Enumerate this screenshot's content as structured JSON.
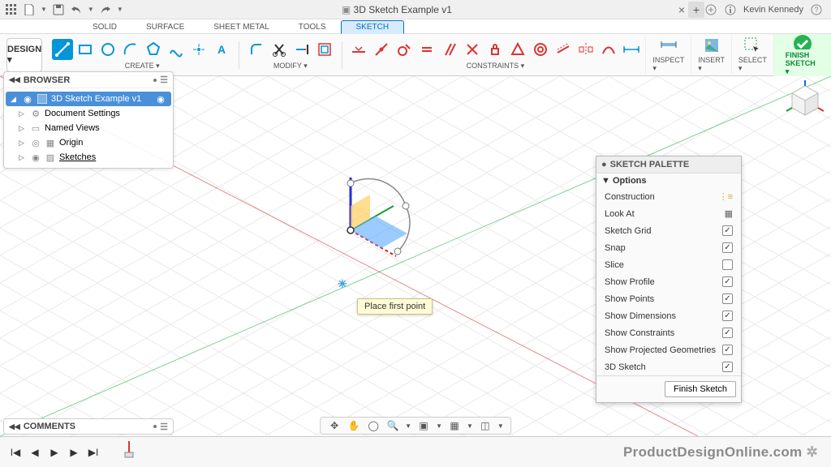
{
  "titlebar": {
    "doc_title": "3D Sketch Example v1",
    "user_name": "Kevin Kennedy"
  },
  "workspace": {
    "design_label": "DESIGN ▾",
    "tabs": [
      "SOLID",
      "SURFACE",
      "SHEET METAL",
      "TOOLS",
      "SKETCH"
    ],
    "active_tab": "SKETCH",
    "groups": {
      "create": "CREATE ▾",
      "modify": "MODIFY ▾",
      "constraints": "CONSTRAINTS ▾",
      "inspect": "INSPECT ▾",
      "insert": "INSERT ▾",
      "select": "SELECT ▾",
      "finish": "FINISH SKETCH ▾"
    }
  },
  "browser": {
    "title": "BROWSER",
    "root": "3D Sketch Example v1",
    "items": [
      {
        "label": "Document Settings",
        "icon": "gear"
      },
      {
        "label": "Named Views",
        "icon": "folder"
      },
      {
        "label": "Origin",
        "icon": "origin"
      },
      {
        "label": "Sketches",
        "icon": "sketch"
      }
    ]
  },
  "canvas": {
    "tooltip": "Place first point"
  },
  "palette": {
    "title": "SKETCH PALETTE",
    "section": "▼ Options",
    "rows": [
      {
        "name": "Construction",
        "type": "icon"
      },
      {
        "name": "Look At",
        "type": "icon"
      },
      {
        "name": "Sketch Grid",
        "type": "check",
        "on": true
      },
      {
        "name": "Snap",
        "type": "check",
        "on": true
      },
      {
        "name": "Slice",
        "type": "check",
        "on": false
      },
      {
        "name": "Show Profile",
        "type": "check",
        "on": true
      },
      {
        "name": "Show Points",
        "type": "check",
        "on": true
      },
      {
        "name": "Show Dimensions",
        "type": "check",
        "on": true
      },
      {
        "name": "Show Constraints",
        "type": "check",
        "on": true
      },
      {
        "name": "Show Projected Geometries",
        "type": "check",
        "on": true
      },
      {
        "name": "3D Sketch",
        "type": "check",
        "on": true
      }
    ],
    "finish": "Finish Sketch"
  },
  "comments": {
    "title": "COMMENTS"
  },
  "watermark": "ProductDesignOnline.com"
}
